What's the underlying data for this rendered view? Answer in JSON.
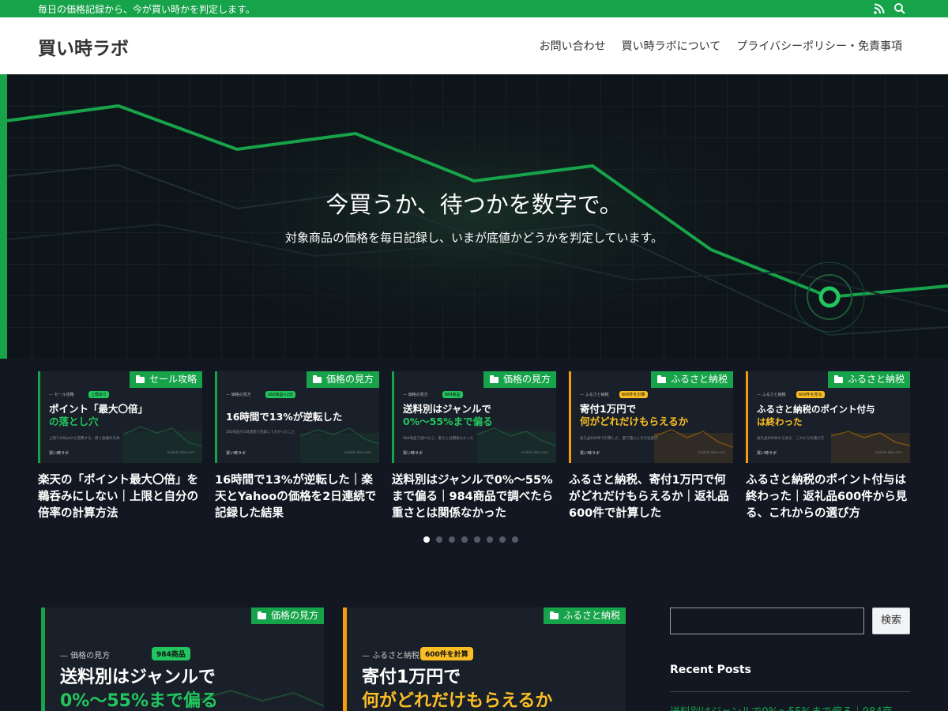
{
  "topbar": {
    "tagline": "毎日の価格記録から、今が買い時かを判定します。",
    "icons": [
      "rss-icon",
      "search-icon"
    ]
  },
  "header": {
    "logo": "買い時ラボ",
    "nav": [
      "お問い合わせ",
      "買い時ラボについて",
      "プライバシーポリシー・免責事項"
    ]
  },
  "hero": {
    "title": "今買うか、待つかを数字で。",
    "subtitle": "対象商品の価格を毎日記録し、いまが底値かどうかを判定しています。"
  },
  "carousel": {
    "slides": [
      {
        "category": "セール攻略",
        "thumb_eyebrow": "セール攻略",
        "thumb_chip": "上限あり",
        "thumb_line1": "ポイント「最大〇倍」",
        "thumb_line2": "の落とし穴",
        "thumb_small": "上限7,000ptから逆算する、買う金額の天井",
        "title": "楽天の「ポイント最大〇倍」を鵜呑みにしない｜上限と自分の倍率の計算方法"
      },
      {
        "category": "価格の見方",
        "thumb_eyebrow": "価格の見方",
        "thumb_chip": "260商品×2日",
        "thumb_line1": "16時間で13%が逆転した",
        "thumb_line2": "",
        "thumb_small": "260商品を2日連続で記録してわかったこと",
        "title": "16時間で13%が逆転した｜楽天とYahooの価格を2日連続で記録した結果"
      },
      {
        "category": "価格の見方",
        "thumb_eyebrow": "価格の見方",
        "thumb_chip": "984商品",
        "thumb_line1": "送料別はジャンルで",
        "thumb_line2": "0%〜55%まで偏る",
        "thumb_small": "984商品で調べたら、重さとは関係なかった",
        "title": "送料別はジャンルで0%〜55%まで偏る｜984商品で調べたら重さとは関係なかった"
      },
      {
        "category": "ふるさと納税",
        "thumb_eyebrow": "ふるさと納税",
        "thumb_chip": "600件を計算",
        "thumb_line1": "寄付1万円で",
        "thumb_line2": "何がどれだけもらえるか",
        "thumb_small": "返礼品600件で計算した、量で選ぶときの注意点",
        "title": "ふるさと納税、寄付1万円で何がどれだけもらえるか｜返礼品600件で計算した"
      },
      {
        "category": "ふるさと納税",
        "thumb_eyebrow": "ふるさと納税",
        "thumb_chip": "600件を見る",
        "thumb_line1": "ふるさと納税のポイント付与",
        "thumb_line2": "は終わった",
        "thumb_small": "返礼品600件から見る、これからの選び方",
        "title": "ふるさと納税のポイント付与は終わった｜返礼品600件から見る、これからの選び方"
      }
    ],
    "thumb_brand": "買い時ラボ",
    "thumb_url": "kaidoki-labo.com",
    "dot_count": 8,
    "active_dot": 0
  },
  "posts": [
    {
      "category": "価格の見方",
      "eyebrow": "価格の見方",
      "chip": "984商品",
      "line1": "送料別はジャンルで",
      "line2": "0%〜55%まで偏る"
    },
    {
      "category": "ふるさと納税",
      "eyebrow": "ふるさと納税",
      "chip": "600件を計算",
      "line1": "寄付1万円で",
      "line2": "何がどれだけもらえるか"
    }
  ],
  "sidebar": {
    "search_button": "検索",
    "search_placeholder": "",
    "recent_heading": "Recent Posts",
    "recent_first": "送料別はジャンルで0%〜55%まで偏る｜984商"
  },
  "colors": {
    "green": "#17a34a",
    "orange": "#f59e0b",
    "yellow": "#fbbf24",
    "background": "#121722"
  }
}
